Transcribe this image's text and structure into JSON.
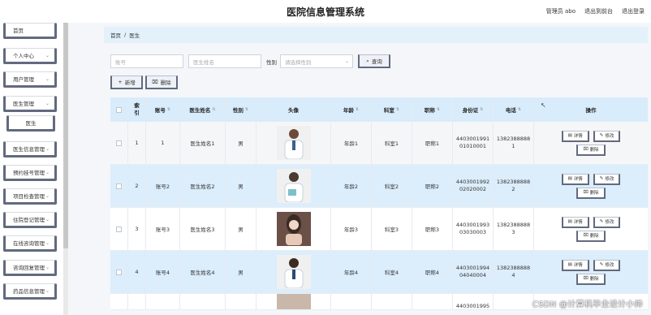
{
  "header": {
    "title": "医院信息管理系统",
    "admin": "管理员 abo",
    "back_frontend": "退出到前台",
    "logout": "退出登录"
  },
  "sidebar": {
    "items": [
      {
        "label": "首页",
        "has_chevron": false
      },
      {
        "label": "个人中心",
        "has_chevron": true
      },
      {
        "label": "用户管理",
        "has_chevron": true
      },
      {
        "label": "医生管理",
        "has_chevron": true
      },
      {
        "label": "医生",
        "sub": true
      },
      {
        "label": "医生信息管理",
        "has_chevron": true
      },
      {
        "label": "预约挂号管理",
        "has_chevron": true
      },
      {
        "label": "项目检查管理",
        "has_chevron": true
      },
      {
        "label": "住院登记管理",
        "has_chevron": true
      },
      {
        "label": "在线咨询管理",
        "has_chevron": true
      },
      {
        "label": "咨询回复管理",
        "has_chevron": true
      },
      {
        "label": "药品信息管理",
        "has_chevron": true
      }
    ]
  },
  "breadcrumb": {
    "home": "首页",
    "sep": "/",
    "current": "医生"
  },
  "search": {
    "account_placeholder": "账号",
    "name_placeholder": "医生姓名",
    "gender_label": "性别",
    "gender_placeholder": "请选择性别",
    "query_label": "查询"
  },
  "actions": {
    "add": "新增",
    "delete": "删除"
  },
  "table": {
    "headers": {
      "index": "索引",
      "account": "账号",
      "name": "医生姓名",
      "gender": "性别",
      "avatar": "头像",
      "age": "年龄",
      "dept": "科室",
      "title": "职称",
      "id_card": "身份证",
      "phone": "电话",
      "ops": "操作"
    },
    "rows": [
      {
        "index": "1",
        "account": "1",
        "name": "医生姓名1",
        "gender": "男",
        "age": "年龄1",
        "dept": "科室1",
        "title": "职称1",
        "id_card": "440300199101010001",
        "phone": "13823888881"
      },
      {
        "index": "2",
        "account": "账号2",
        "name": "医生姓名2",
        "gender": "男",
        "age": "年龄2",
        "dept": "科室2",
        "title": "职称2",
        "id_card": "440300199202020002",
        "phone": "13823888882"
      },
      {
        "index": "3",
        "account": "账号3",
        "name": "医生姓名3",
        "gender": "男",
        "age": "年龄3",
        "dept": "科室3",
        "title": "职称3",
        "id_card": "440300199303030003",
        "phone": "13823888883"
      },
      {
        "index": "4",
        "account": "账号4",
        "name": "医生姓名4",
        "gender": "男",
        "age": "年龄4",
        "dept": "科室4",
        "title": "职称4",
        "id_card": "440300199404040004",
        "phone": "13823888884"
      }
    ],
    "partial_row_id": "4403001995",
    "op_detail": "详情",
    "op_edit": "修改",
    "op_delete": "删除"
  },
  "watermark": "CSDN @计算机毕业设计小帅",
  "colors": {
    "accent": "#626a7e",
    "header_bg": "#d8ecfb",
    "stripe": "#dcedfb"
  }
}
